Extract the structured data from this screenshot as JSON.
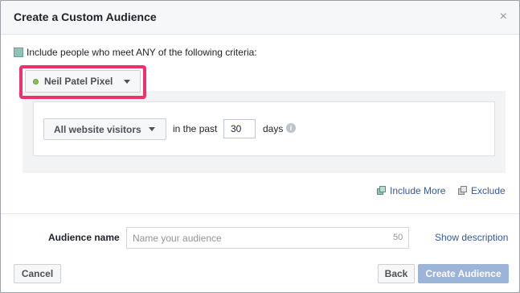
{
  "dialog": {
    "title": "Create a Custom Audience",
    "close_glyph": "×"
  },
  "criteria": {
    "text": "Include people who meet ANY of the following criteria:"
  },
  "pixel": {
    "label": "Neil Patel Pixel",
    "status_color": "#8bc34a"
  },
  "rule": {
    "visitors_label": "All website visitors",
    "in_past_label": "in the past",
    "days_value": "30",
    "days_label": "days",
    "info_glyph": "i"
  },
  "actions": {
    "include_more": "Include More",
    "exclude": "Exclude"
  },
  "audience": {
    "label": "Audience name",
    "placeholder": "Name your audience",
    "char_count": "50",
    "show_description": "Show description"
  },
  "footer": {
    "cancel": "Cancel",
    "back": "Back",
    "create": "Create Audience"
  },
  "colors": {
    "highlight": "#f0306a",
    "link": "#365899",
    "primary_disabled": "#9cb4d8"
  }
}
